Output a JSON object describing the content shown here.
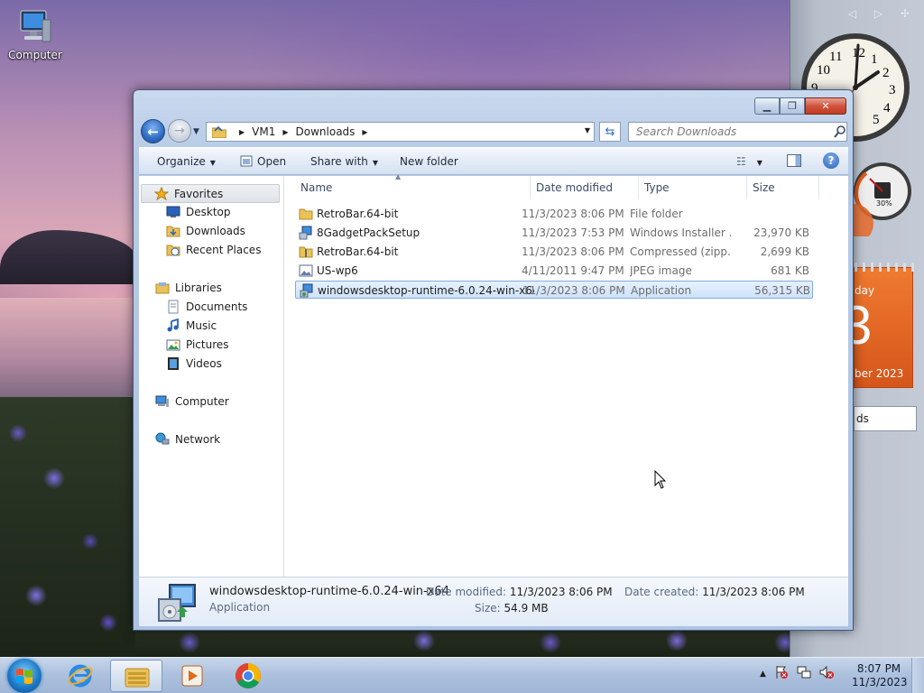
{
  "desktop": {
    "icons": [
      {
        "label": "Computer",
        "icon": "computer-icon"
      }
    ]
  },
  "gadgets": {
    "sidebar_controls": "◁ ▷ ✢",
    "clock": {
      "numerals": [
        "12",
        "1",
        "2",
        "3",
        "4",
        "5",
        "10",
        "11",
        "9"
      ]
    },
    "cpu_meter": {
      "percent_label": "30%",
      "percent": 30
    },
    "calendar": {
      "weekday_fragment": "day",
      "day_fragment": "3",
      "month_fragment": "ber 2023"
    },
    "feed_fragment": "ds"
  },
  "explorer": {
    "nav": {
      "back": "back-icon",
      "forward": "forward-icon"
    },
    "address": {
      "crumbs": [
        "VM1",
        "Downloads"
      ]
    },
    "search": {
      "placeholder": "Search Downloads"
    },
    "commands": {
      "organize": "Organize",
      "open": "Open",
      "share_with": "Share with",
      "new_folder": "New folder"
    },
    "navpane": {
      "favorites": "Favorites",
      "desktop": "Desktop",
      "downloads": "Downloads",
      "recent_places": "Recent Places",
      "libraries": "Libraries",
      "documents": "Documents",
      "music": "Music",
      "pictures": "Pictures",
      "videos": "Videos",
      "computer": "Computer",
      "network": "Network"
    },
    "columns": {
      "name": "Name",
      "date": "Date modified",
      "type": "Type",
      "size": "Size"
    },
    "files": [
      {
        "name": "RetroBar.64-bit",
        "date": "11/3/2023 8:06 PM",
        "type": "File folder",
        "size": "",
        "icon": "folder-icon"
      },
      {
        "name": "8GadgetPackSetup",
        "date": "11/3/2023 7:53 PM",
        "type": "Windows Installer ...",
        "size": "23,970 KB",
        "icon": "installer-icon"
      },
      {
        "name": "RetroBar.64-bit",
        "date": "11/3/2023 8:06 PM",
        "type": "Compressed (zipp...",
        "size": "2,699 KB",
        "icon": "zip-folder-icon"
      },
      {
        "name": "US-wp6",
        "date": "4/11/2011 9:47 PM",
        "type": "JPEG image",
        "size": "681 KB",
        "icon": "image-icon"
      },
      {
        "name": "windowsdesktop-runtime-6.0.24-win-x64",
        "date": "11/3/2023 8:06 PM",
        "type": "Application",
        "size": "56,315 KB",
        "icon": "application-icon",
        "selected": true
      }
    ],
    "details": {
      "name": "windowsdesktop-runtime-6.0.24-win-x64",
      "kind": "Application",
      "date_modified_label": "Date modified:",
      "date_modified": "11/3/2023 8:06 PM",
      "date_created_label": "Date created:",
      "date_created": "11/3/2023 8:06 PM",
      "size_label": "Size:",
      "size": "54.9 MB"
    }
  },
  "taskbar": {
    "buttons": [
      "start-button",
      "internet-explorer-icon",
      "file-explorer-icon",
      "media-player-icon",
      "chrome-icon"
    ],
    "tray": {
      "expand": "▲"
    },
    "clock": {
      "time": "8:07 PM",
      "date": "11/3/2023"
    }
  },
  "colors": {
    "accent": "#3a6fbf",
    "selection": "#cde2fa",
    "calendar": "#e8692a"
  }
}
